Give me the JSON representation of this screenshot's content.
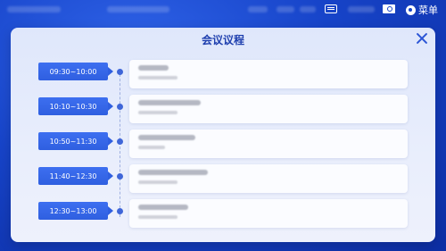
{
  "topbar": {
    "menu_label": "菜单",
    "icons": [
      "keyboard-icon",
      "camera-icon",
      "menu-icon"
    ]
  },
  "dialog": {
    "title": "会议议程",
    "close_icon": "close-icon",
    "items": [
      {
        "time": "09:30~10:00"
      },
      {
        "time": "10:10~10:30"
      },
      {
        "time": "10:50~11:30"
      },
      {
        "time": "11:40~12:30"
      },
      {
        "time": "12:30~13:00"
      }
    ]
  },
  "colors": {
    "background": "#1744c9",
    "accent": "#2f5fe0",
    "title": "#1e3fae"
  }
}
